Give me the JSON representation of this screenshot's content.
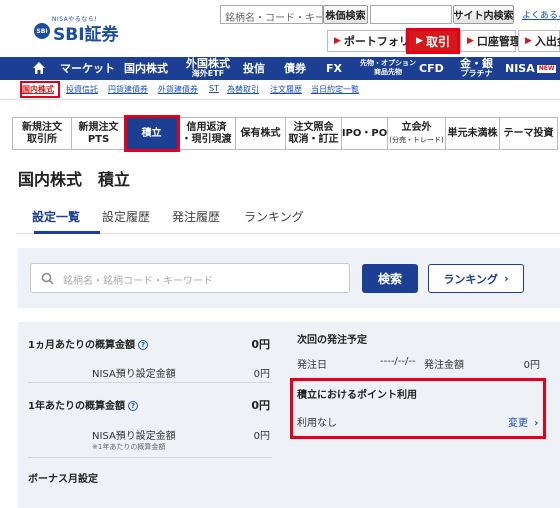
{
  "header": {
    "logo_tagline": "NISAやるなら!",
    "logo_badge": "SBI",
    "logo_text": "SBI証券",
    "search_placeholder": "銘柄名・コード・キーワ",
    "stock_search_label": "株価検索",
    "site_search_label": "サイト内検索",
    "faq_label": "よくあるご",
    "portfolio_label": "ポートフォリオ",
    "trade_label": "取引",
    "account_label": "口座管理",
    "deposit_label": "入出金"
  },
  "nav": {
    "items": [
      {
        "label": "マーケット",
        "sub": ""
      },
      {
        "label": "国内株式",
        "sub": ""
      },
      {
        "label": "外国株式",
        "sub": "海外ETF"
      },
      {
        "label": "投信",
        "sub": ""
      },
      {
        "label": "債券",
        "sub": ""
      },
      {
        "label": "FX",
        "sub": ""
      },
      {
        "label": "先物・オプション",
        "sub": "商品先物"
      },
      {
        "label": "CFD",
        "sub": ""
      },
      {
        "label": "金・銀",
        "sub": "プラチナ"
      },
      {
        "label": "NISA",
        "sub": ""
      }
    ],
    "new_badge": "NEW"
  },
  "subnav": [
    "国内株式",
    "投資信託",
    "円貨建債券",
    "外貨建債券",
    "ST",
    "為替取引",
    "注文履歴",
    "当日約定一覧"
  ],
  "tabs": [
    {
      "line1": "新規注文",
      "line2": "取引所",
      "small": ""
    },
    {
      "line1": "新規注文",
      "line2": "PTS",
      "small": ""
    },
    {
      "line1": "積立",
      "line2": "",
      "small": ""
    },
    {
      "line1": "信用返済",
      "line2": "・現引現渡",
      "small": ""
    },
    {
      "line1": "保有株式",
      "line2": "",
      "small": ""
    },
    {
      "line1": "注文照会",
      "line2": "取消・訂正",
      "small": ""
    },
    {
      "line1": "IPO・PO",
      "line2": "",
      "small": ""
    },
    {
      "line1": "立会外",
      "line2": "",
      "small": "(分売・トレード)"
    },
    {
      "line1": "単元未満株",
      "line2": "",
      "small": ""
    },
    {
      "line1": "テーマ投資",
      "line2": "",
      "small": ""
    }
  ],
  "page_title": "国内株式　積立",
  "sub_tabs": [
    "設定一覧",
    "設定履歴",
    "発注履歴",
    "ランキング"
  ],
  "search": {
    "placeholder": "銘柄名・銘柄コード・キーワード",
    "button": "検索",
    "ranking_button": "ランキング"
  },
  "summary": {
    "monthly_label": "1ヵ月あたりの概算金額",
    "monthly_value": "0円",
    "monthly_nisa_label": "NISA預り設定金額",
    "monthly_nisa_value": "0円",
    "yearly_label": "1年あたりの概算金額",
    "yearly_value": "0円",
    "yearly_nisa_label": "NISA預り設定金額",
    "yearly_nisa_value": "0円",
    "yearly_note": "※1年あたりの概算金額",
    "bonus_label": "ボーナス月設定",
    "next_order_label": "次回の発注予定",
    "order_date_label": "発注日",
    "order_date_value": "----/--/--",
    "order_amount_label": "発注金額",
    "order_amount_value": "0円",
    "point_title": "積立におけるポイント利用",
    "point_status": "利用なし",
    "change_label": "変更"
  },
  "colors": {
    "navy": "#1c3f94",
    "red": "#d3191c",
    "panel": "#eef2f6",
    "link": "#1a4dbd"
  }
}
